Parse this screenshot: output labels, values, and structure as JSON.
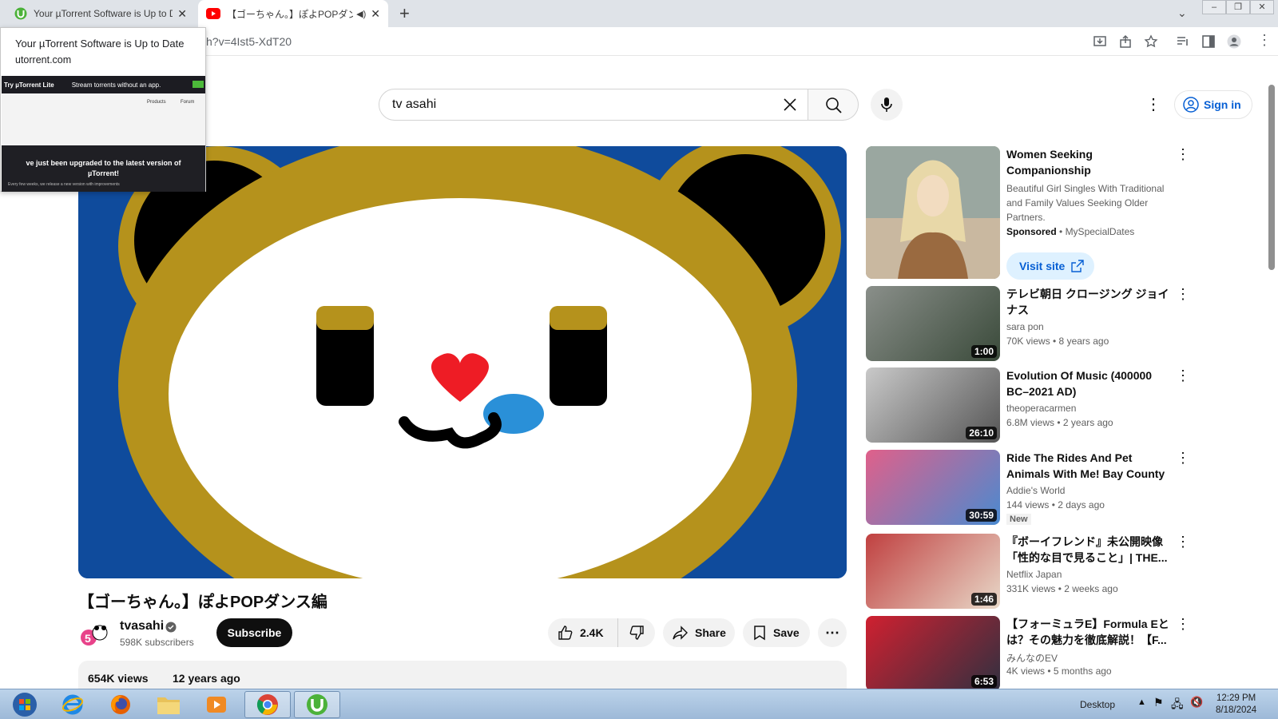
{
  "browser": {
    "tabs": [
      {
        "title": "Your µTorrent Software is Up to D",
        "icon": "utorrent-icon"
      },
      {
        "title": "【ゴーちゃん。】ぽよPOPダンス編",
        "icon": "youtube-icon"
      }
    ],
    "new_tab_label": "+",
    "url": "h?v=4Ist5-XdT20"
  },
  "popup": {
    "title": "Your µTorrent Software is Up to Date",
    "url": "utorrent.com",
    "thumb_bar_text": "Stream torrents without an app.",
    "thumb_bar_brand": "Try µTorrent Lite",
    "thumb_nav_products": "Products",
    "thumb_nav_forum": "Forum",
    "thumb_dark_line1": "ve just been upgraded to the latest version of",
    "thumb_dark_line2": "µTorrent!",
    "thumb_dark_small": "Every few weeks, we release a new version with improvements"
  },
  "youtube": {
    "search_value": "tv asahi",
    "signin_label": "Sign in",
    "video_title": "【ゴーちゃん。】ぽよPOPダンス編",
    "channel": {
      "name": "tvasahi",
      "subscribers": "598K subscribers"
    },
    "subscribe_label": "Subscribe",
    "likes": "2.4K",
    "share_label": "Share",
    "save_label": "Save",
    "views": "654K views",
    "age": "12 years ago"
  },
  "ad": {
    "title": "Women Seeking Companionship",
    "description": "Beautiful Girl Singles With Traditional and Family Values Seeking Older Partners.",
    "sponsored": "Sponsored",
    "advertiser": "MySpecialDates",
    "visit_label": "Visit site"
  },
  "recommendations": [
    {
      "title": "テレビ朝日 クロージング ジョイナス",
      "channel": "sara pon",
      "meta": "70K views • 8 years ago",
      "duration": "1:00",
      "colors": [
        "#8a8f8a",
        "#3a4a3a"
      ]
    },
    {
      "title": "Evolution Of Music (400000 BC–2021 AD)",
      "channel": "theoperacarmen",
      "meta": "6.8M views • 2 years ago",
      "duration": "26:10",
      "colors": [
        "#c9c9c9",
        "#555555"
      ]
    },
    {
      "title": "Ride The Rides And Pet Animals With Me! Bay County Fair!!!",
      "channel": "Addie's World",
      "meta": "144 views • 2 days ago",
      "duration": "30:59",
      "badge": "New",
      "colors": [
        "#e0608a",
        "#4a8ad0"
      ]
    },
    {
      "title": "『ボーイフレンド』未公開映像「性的な目で見ること」| THE...",
      "channel": "Netflix Japan",
      "meta": "331K views • 2 weeks ago",
      "duration": "1:46",
      "colors": [
        "#c04040",
        "#e8d8c8"
      ]
    },
    {
      "title": "【フォーミュラE】Formula Eとは？その魅力を徹底解説！【F...",
      "channel": "みんなのEV",
      "meta": "4K views • 5 months ago",
      "duration": "6:53",
      "colors": [
        "#d02030",
        "#303040"
      ]
    }
  ],
  "taskbar": {
    "apps": [
      "windows-start",
      "internet-explorer",
      "firefox",
      "file-explorer",
      "media-player",
      "chrome",
      "utorrent"
    ],
    "desktop_label": "Desktop",
    "time": "12:29 PM",
    "date": "8/18/2024"
  },
  "colors": {
    "video_bg": "#0f4b9c",
    "bear_gold": "#b5921c",
    "accent_blue": "#065fd4"
  }
}
